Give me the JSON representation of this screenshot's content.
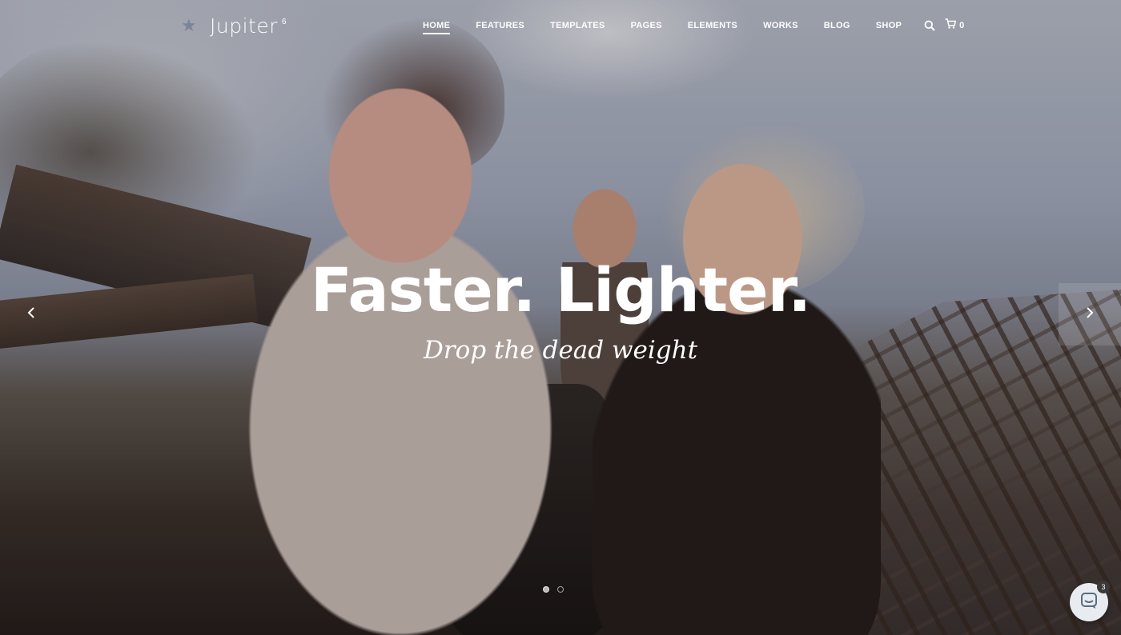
{
  "brand": {
    "name": "Jupiter",
    "version_sup": "6"
  },
  "nav": {
    "items": [
      {
        "label": "HOME",
        "active": true
      },
      {
        "label": "FEATURES",
        "active": false
      },
      {
        "label": "TEMPLATES",
        "active": false
      },
      {
        "label": "PAGES",
        "active": false
      },
      {
        "label": "ELEMENTS",
        "active": false
      },
      {
        "label": "WORKS",
        "active": false
      },
      {
        "label": "BLOG",
        "active": false
      },
      {
        "label": "SHOP",
        "active": false
      }
    ],
    "search_icon": "search-icon",
    "cart_icon": "cart-icon",
    "cart_count": "0"
  },
  "hero": {
    "headline": "Faster. Lighter.",
    "subline": "Drop the dead weight",
    "prev_icon": "chevron-left-icon",
    "next_icon": "chevron-right-icon",
    "slides_total": 2,
    "active_slide": 1
  },
  "chat": {
    "badge_count": "3",
    "icon": "chat-icon"
  },
  "colors": {
    "text": "#ffffff",
    "chat_bg": "#e8ecf1",
    "badge_bg": "#3a3a3a"
  }
}
